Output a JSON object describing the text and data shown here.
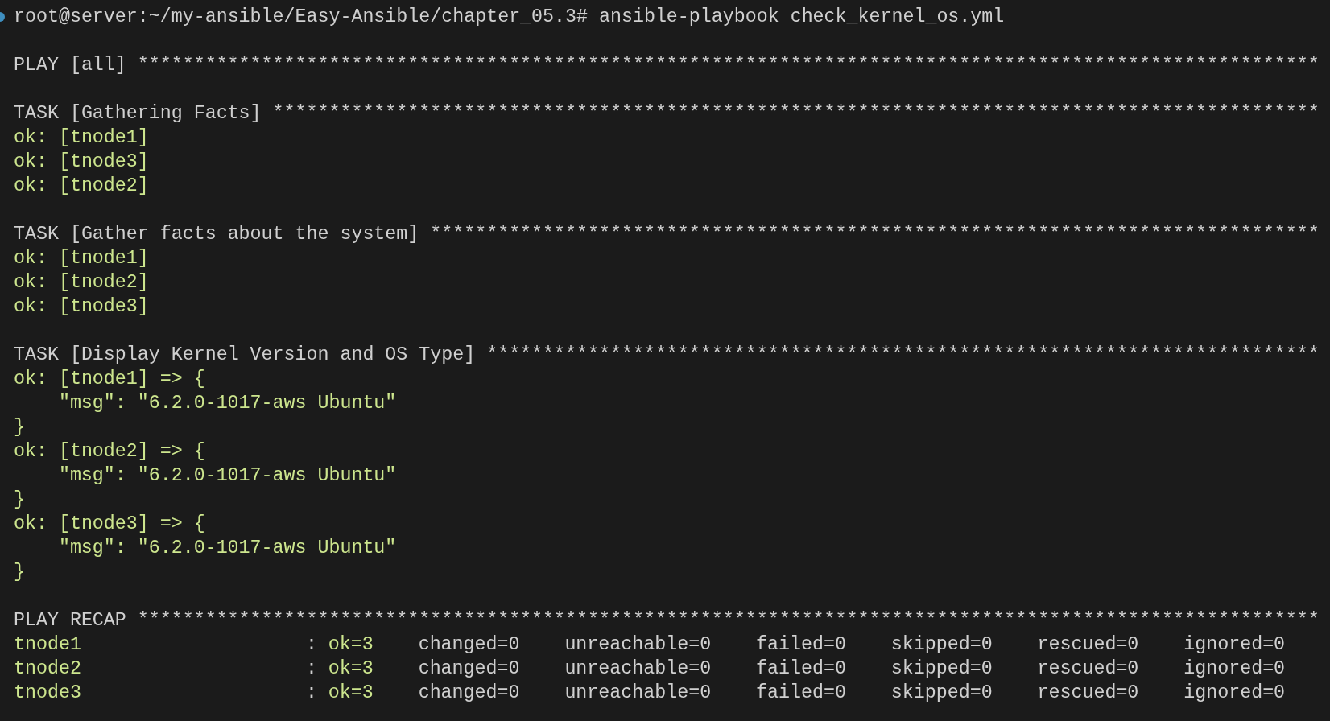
{
  "prompt": {
    "text": "root@server:~/my-ansible/Easy-Ansible/chapter_05.3# ansible-playbook check_kernel_os.yml"
  },
  "sections": [
    {
      "heading": "PLAY [all]",
      "rule": "*********************************************************************************************************"
    },
    {
      "heading": "TASK [Gathering Facts]",
      "rule": "*********************************************************************************************",
      "lines": [
        {
          "kind": "result",
          "text": "ok: [tnode1]"
        },
        {
          "kind": "result",
          "text": "ok: [tnode3]"
        },
        {
          "kind": "result",
          "text": "ok: [tnode2]"
        }
      ]
    },
    {
      "heading": "TASK [Gather facts about the system]",
      "rule": "*******************************************************************************",
      "lines": [
        {
          "kind": "result",
          "text": "ok: [tnode1]"
        },
        {
          "kind": "result",
          "text": "ok: [tnode2]"
        },
        {
          "kind": "result",
          "text": "ok: [tnode3]"
        }
      ]
    },
    {
      "heading": "TASK [Display Kernel Version and OS Type]",
      "rule": "**************************************************************************",
      "lines": [
        {
          "kind": "result",
          "text": "ok: [tnode1] => {"
        },
        {
          "kind": "detail",
          "text": "\"msg\": \"6.2.0-1017-aws Ubuntu\""
        },
        {
          "kind": "result",
          "text": "}"
        },
        {
          "kind": "result",
          "text": "ok: [tnode2] => {"
        },
        {
          "kind": "detail",
          "text": "\"msg\": \"6.2.0-1017-aws Ubuntu\""
        },
        {
          "kind": "result",
          "text": "}"
        },
        {
          "kind": "result",
          "text": "ok: [tnode3] => {"
        },
        {
          "kind": "detail",
          "text": "\"msg\": \"6.2.0-1017-aws Ubuntu\""
        },
        {
          "kind": "result",
          "text": "}"
        }
      ]
    }
  ],
  "recap": {
    "heading": "PLAY RECAP",
    "rule": "*********************************************************************************************************",
    "rows": [
      {
        "host": "tnode1",
        "separator": ":",
        "stats": [
          {
            "kind": "ok",
            "text": "ok=3"
          },
          {
            "kind": "plain",
            "text": "changed=0"
          },
          {
            "kind": "plain",
            "text": "unreachable=0"
          },
          {
            "kind": "plain",
            "text": "failed=0"
          },
          {
            "kind": "plain",
            "text": "skipped=0"
          },
          {
            "kind": "plain",
            "text": "rescued=0"
          },
          {
            "kind": "plain",
            "text": "ignored=0"
          }
        ]
      },
      {
        "host": "tnode2",
        "separator": ":",
        "stats": [
          {
            "kind": "ok",
            "text": "ok=3"
          },
          {
            "kind": "plain",
            "text": "changed=0"
          },
          {
            "kind": "plain",
            "text": "unreachable=0"
          },
          {
            "kind": "plain",
            "text": "failed=0"
          },
          {
            "kind": "plain",
            "text": "skipped=0"
          },
          {
            "kind": "plain",
            "text": "rescued=0"
          },
          {
            "kind": "plain",
            "text": "ignored=0"
          }
        ]
      },
      {
        "host": "tnode3",
        "separator": ":",
        "stats": [
          {
            "kind": "ok",
            "text": "ok=3"
          },
          {
            "kind": "plain",
            "text": "changed=0"
          },
          {
            "kind": "plain",
            "text": "unreachable=0"
          },
          {
            "kind": "plain",
            "text": "failed=0"
          },
          {
            "kind": "plain",
            "text": "skipped=0"
          },
          {
            "kind": "plain",
            "text": "rescued=0"
          },
          {
            "kind": "plain",
            "text": "ignored=0"
          }
        ]
      }
    ]
  }
}
